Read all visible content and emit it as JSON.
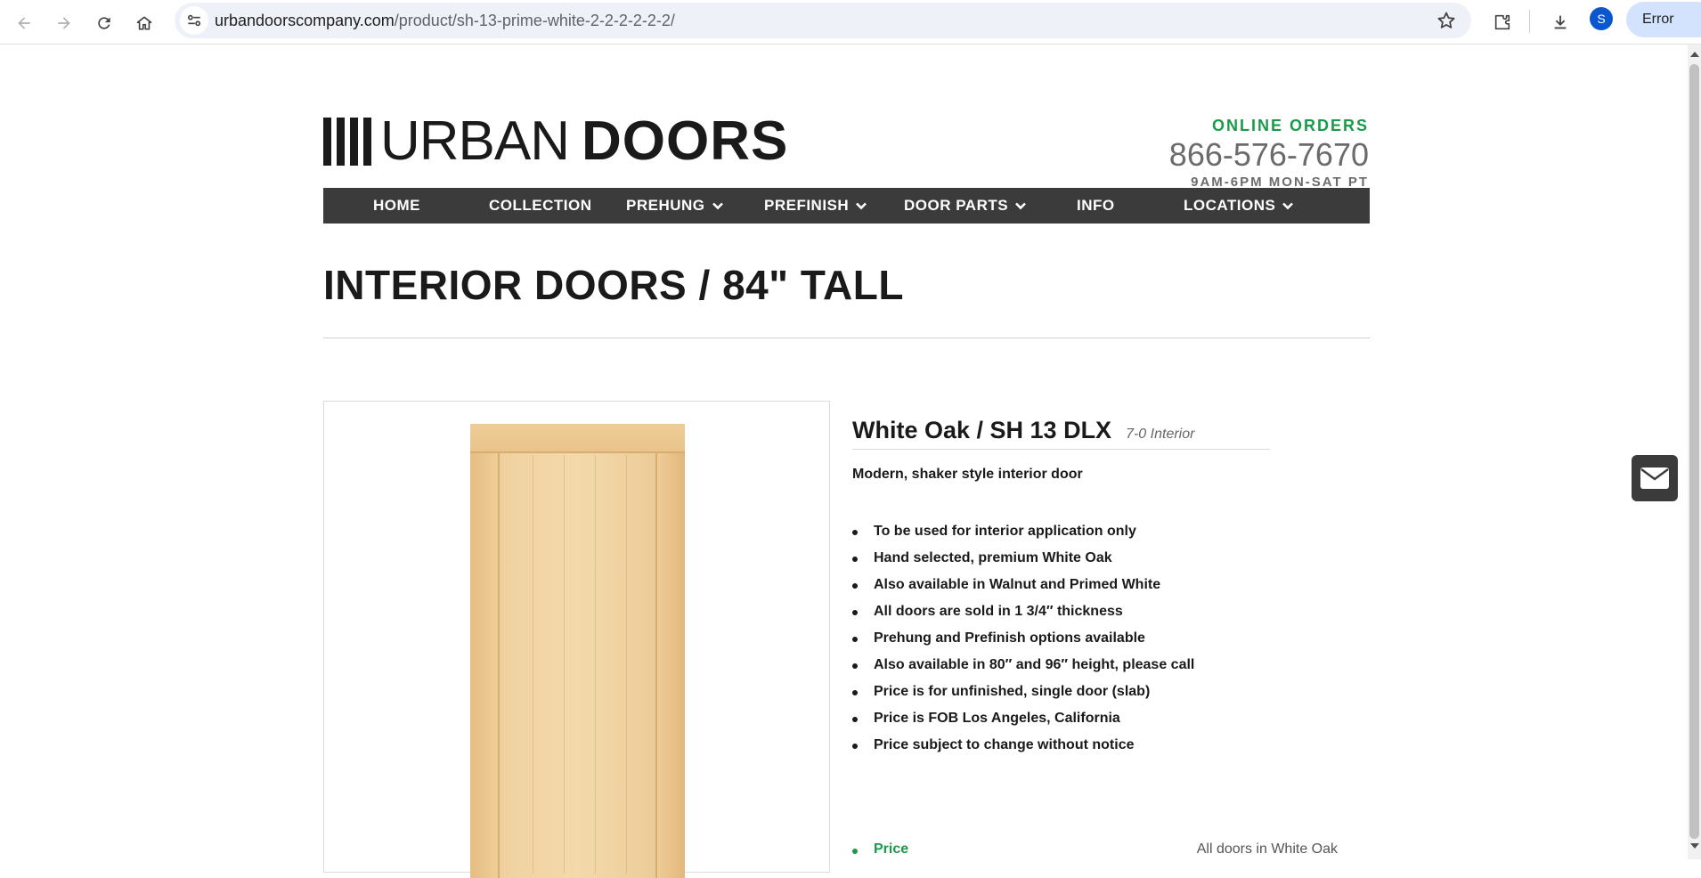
{
  "browser": {
    "url_host": "urbandoorscompany.com",
    "url_path": "/product/sh-13-prime-white-2-2-2-2-2-2/",
    "profile_initial": "S",
    "status_pill": "Error",
    "icons": [
      "back-icon",
      "forward-icon",
      "reload-icon",
      "home-icon",
      "site-info-icon",
      "star-icon",
      "extensions-icon",
      "download-icon",
      "kebab-menu-icon"
    ]
  },
  "header": {
    "logo_urban": "URBAN",
    "logo_doors": "DOORS",
    "online_orders": "ONLINE ORDERS",
    "phone": "866-576-7670",
    "hours": "9AM-6PM  MON-SAT  PT"
  },
  "nav": {
    "items": [
      {
        "label": "HOME"
      },
      {
        "label": "COLLECTION"
      },
      {
        "label": "PREHUNG"
      },
      {
        "label": "PREFINISH"
      },
      {
        "label": "DOOR PARTS"
      },
      {
        "label": "INFO"
      },
      {
        "label": "LOCATIONS"
      }
    ]
  },
  "page": {
    "title": "INTERIOR DOORS / 84\" TALL"
  },
  "product": {
    "name": "White Oak / SH 13 DLX",
    "subtitle": "7-0 Interior",
    "tagline": "Modern, shaker style interior door",
    "features": [
      "To be used for interior application only",
      "Hand selected, premium White Oak",
      "Also available in Walnut and Primed White",
      "All doors are sold in 1 3/4″ thickness",
      "Prehung and Prefinish options available",
      "Also available in 80″ and 96″ height, please call",
      "Price is for unfinished, single door (slab)",
      "Price is FOB Los Angeles, California",
      "Price subject to change without notice"
    ],
    "price_label": "Price",
    "price_note": "All doors in White Oak"
  },
  "colors": {
    "accent_green": "#1a9a4a",
    "nav_bg": "#3b3b3b",
    "text_dark": "#1a1a1a",
    "text_grey": "#6b6b6b"
  }
}
